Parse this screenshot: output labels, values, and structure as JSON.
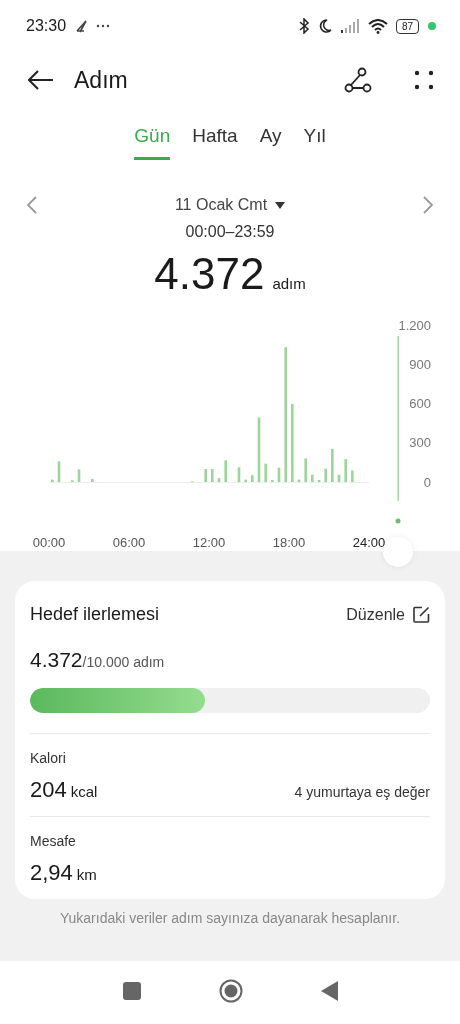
{
  "status_bar": {
    "time": "23:30",
    "battery": "87"
  },
  "header": {
    "title": "Adım"
  },
  "tabs": [
    {
      "label": "Gün",
      "selected": true
    },
    {
      "label": "Hafta",
      "selected": false
    },
    {
      "label": "Ay",
      "selected": false
    },
    {
      "label": "Yıl",
      "selected": false
    }
  ],
  "date_nav": {
    "date": "11 Ocak Cmt",
    "range": "00:00–23:59"
  },
  "total": {
    "value": "4.372",
    "unit": "adım"
  },
  "chart": {
    "chart_data": {
      "type": "bar",
      "x": [
        0.25,
        0.75,
        1.75,
        2.25,
        3.25,
        10.75,
        11.75,
        12.25,
        12.75,
        13.25,
        14.25,
        14.75,
        15.25,
        15.75,
        16.25,
        16.75,
        17.25,
        17.75,
        18.25,
        18.75,
        19.25,
        19.75,
        20.25,
        20.75,
        21.25,
        21.75,
        22.25,
        22.75
      ],
      "values": [
        18,
        158,
        13,
        97,
        23,
        5,
        99,
        99,
        30,
        165,
        112,
        18,
        51,
        493,
        140,
        15,
        109,
        1030,
        597,
        18,
        180,
        56,
        15,
        102,
        252,
        56,
        175,
        89
      ],
      "xlim": [
        0,
        24
      ],
      "ylim": [
        0,
        1200
      ],
      "xticks": [
        {
          "value": 0,
          "label": "00:00"
        },
        {
          "value": 6,
          "label": "06:00"
        },
        {
          "value": 12,
          "label": "12:00"
        },
        {
          "value": 18,
          "label": "18:00"
        },
        {
          "value": 24,
          "label": "24:00"
        }
      ],
      "yticks": [
        {
          "value": 0,
          "label": "0"
        },
        {
          "value": 300,
          "label": "300"
        },
        {
          "value": 600,
          "label": "600"
        },
        {
          "value": 900,
          "label": "900"
        },
        {
          "value": 1200,
          "label": "1.200"
        }
      ]
    }
  },
  "goal": {
    "title": "Hedef ilerlemesi",
    "edit": "Düzenle",
    "value": "4.372",
    "target": "/10.000 adım",
    "level": 0.4372
  },
  "stats": [
    {
      "label": "Kalori",
      "value": "204",
      "unit": "kcal",
      "note": "4 yumurtaya eş değer"
    },
    {
      "label": "Mesafe",
      "value": "2,94",
      "unit": "km"
    }
  ],
  "footnote": "Yukarıdaki veriler adım sayınıza dayanarak hesaplanır."
}
